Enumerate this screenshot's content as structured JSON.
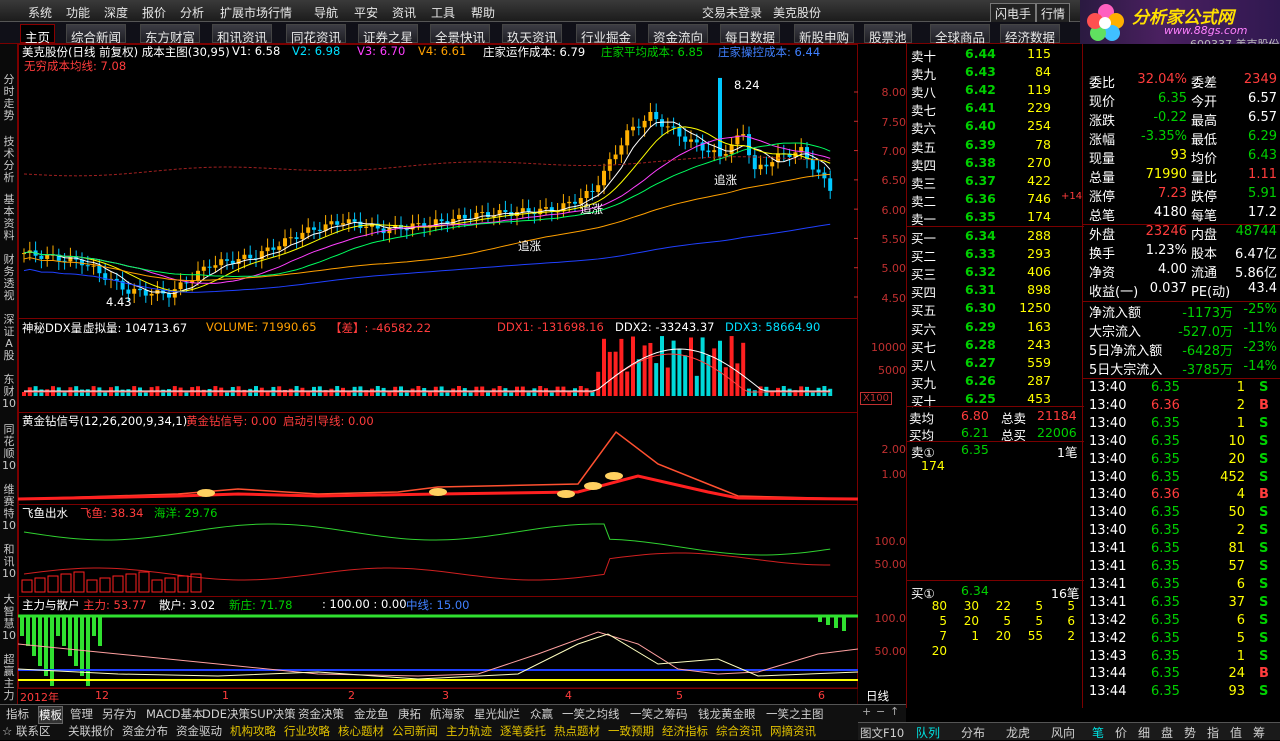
{
  "menu": [
    "系统",
    "功能",
    "深度",
    "报价",
    "分析",
    "扩展市场行情",
    "导航",
    "平安",
    "资讯",
    "工具",
    "帮助"
  ],
  "status": {
    "login": "交易未登录",
    "stock": "美克股份",
    "btn1": "闪电手",
    "btn2": "行情"
  },
  "logo": {
    "title": "分析家公式网",
    "url": "www.88gs.com",
    "code": "600337 美克股份"
  },
  "tabs": [
    "主页",
    "综合新闻",
    "东方财富",
    "和讯资讯",
    "同花资讯",
    "证券之星",
    "全景快讯",
    "玖天资讯",
    "行业掘金",
    "资金流向",
    "每日数据",
    "新股申购",
    "股票池",
    "全球商品",
    "经济数据"
  ],
  "left_nav": [
    "分时走势",
    "技术分析",
    "基本资料",
    "财务透视",
    "深证A股",
    "东财10",
    "同花顺10",
    "维赛特10",
    "和讯10",
    "大智慧10",
    "超赢主力"
  ],
  "main_panel": {
    "title": "美克股份(日线 前复权) 成本主图(30,95)",
    "v1": "V1: 6.58",
    "v2": "V2: 6.98",
    "v3": "V3: 6.70",
    "v4": "V4: 6.61",
    "zhuang": "庄家运作成本: 6.79",
    "avg": "庄家平均成本: 6.85",
    "zhuang2": "庄家操控成本: 6.44",
    "inf": "无穷成本均线: 7.08",
    "hi": "8.24",
    "lo": "4.43",
    "tag1": "追涨",
    "tag2": "追涨",
    "tag3": "追涨",
    "yticks": [
      "8.00",
      "7.50",
      "7.00",
      "6.50",
      "6.00",
      "5.50",
      "5.00",
      "4.50"
    ]
  },
  "ddx_panel": {
    "title": "神秘DDX量",
    "virt": "虚拟量: 104713.67",
    "vol": "VOLUME: 71990.65",
    "diff": "【差】: -46582.22",
    "ddx1": "DDX1: -131698.16",
    "ddx2": "DDX2: -33243.37",
    "ddx3": "DDX3: 58664.90",
    "yticks": [
      "10000",
      "5000"
    ],
    "x100": "X100",
    "buy": "买",
    "sell": "卖"
  },
  "gold_panel": {
    "title": "黄金钻信号(12,26,200,9,34,1)",
    "sig": "黄金钻信号: 0.00",
    "guide": "启动引导线: 0.00",
    "yticks": [
      "2.00",
      "1.00"
    ]
  },
  "fish_panel": {
    "title": "飞鱼出水",
    "fish": "飞鱼: 38.34",
    "sea": "海洋: 29.76",
    "yticks": [
      "100.0",
      "50.00"
    ]
  },
  "main_retail": {
    "title": "主力与散户",
    "main": "主力: 53.77",
    "retail": "散户: 3.02",
    "new": "新庄: 71.78",
    "fixed": ": 100.00 : 0.00",
    "mid": "中线: 15.00",
    "yticks": [
      "100.0",
      "50.00"
    ]
  },
  "xaxis": {
    "year": "2012年",
    "labels": [
      "12",
      "1",
      "2",
      "3",
      "4",
      "5",
      "6"
    ],
    "period": "日线"
  },
  "chart_data": {
    "type": "candlestick",
    "ylim": [
      4.3,
      8.4
    ],
    "price_ticks": [
      8.0,
      7.5,
      7.0,
      6.5,
      6.0,
      5.5,
      5.0,
      4.5
    ],
    "high": 8.24,
    "low": 4.43,
    "last": 6.35
  },
  "sell_book": [
    {
      "label": "卖十",
      "price": "6.44",
      "vol": "115"
    },
    {
      "label": "卖九",
      "price": "6.43",
      "vol": "84"
    },
    {
      "label": "卖八",
      "price": "6.42",
      "vol": "119"
    },
    {
      "label": "卖七",
      "price": "6.41",
      "vol": "229"
    },
    {
      "label": "卖六",
      "price": "6.40",
      "vol": "254"
    },
    {
      "label": "卖五",
      "price": "6.39",
      "vol": "78"
    },
    {
      "label": "卖四",
      "price": "6.38",
      "vol": "270"
    },
    {
      "label": "卖三",
      "price": "6.37",
      "vol": "422"
    },
    {
      "label": "卖二",
      "price": "6.36",
      "vol": "746",
      "ex": "+14"
    },
    {
      "label": "卖一",
      "price": "6.35",
      "vol": "174"
    }
  ],
  "buy_book": [
    {
      "label": "买一",
      "price": "6.34",
      "vol": "288"
    },
    {
      "label": "买二",
      "price": "6.33",
      "vol": "293"
    },
    {
      "label": "买三",
      "price": "6.32",
      "vol": "406"
    },
    {
      "label": "买四",
      "price": "6.31",
      "vol": "898"
    },
    {
      "label": "买五",
      "price": "6.30",
      "vol": "1250"
    },
    {
      "label": "买六",
      "price": "6.29",
      "vol": "163"
    },
    {
      "label": "买七",
      "price": "6.28",
      "vol": "243"
    },
    {
      "label": "买八",
      "price": "6.27",
      "vol": "559"
    },
    {
      "label": "买九",
      "price": "6.26",
      "vol": "287"
    },
    {
      "label": "买十",
      "price": "6.25",
      "vol": "453"
    }
  ],
  "book_summary": {
    "sell_avg_l": "卖均",
    "sell_avg": "6.80",
    "sell_tot_l": "总卖",
    "sell_tot": "21184",
    "buy_avg_l": "买均",
    "buy_avg": "6.21",
    "buy_tot_l": "总买",
    "buy_tot": "22006"
  },
  "queue": {
    "s1": "卖①",
    "s1p": "6.35",
    "s1n": "1笔",
    "s1v": "174",
    "b1": "买①",
    "b1p": "6.34",
    "b1n": "16笔",
    "rows": [
      [
        "80",
        "30",
        "22",
        "5",
        "5"
      ],
      [
        "5",
        "20",
        "5",
        "5",
        "6"
      ],
      [
        "7",
        "1",
        "20",
        "55",
        "2"
      ],
      [
        "20",
        "",
        "",
        "",
        ""
      ]
    ]
  },
  "quote": [
    {
      "l1": "委比",
      "v1": "32.04%",
      "l2": "委差",
      "v2": "2349",
      "c1": "red",
      "c2": "red"
    },
    {
      "l1": "现价",
      "v1": "6.35",
      "l2": "今开",
      "v2": "6.57",
      "c1": "grn",
      "c2": "wht"
    },
    {
      "l1": "涨跌",
      "v1": "-0.22",
      "l2": "最高",
      "v2": "6.57",
      "c1": "grn",
      "c2": "wht"
    },
    {
      "l1": "涨幅",
      "v1": "-3.35%",
      "l2": "最低",
      "v2": "6.29",
      "c1": "grn",
      "c2": "grn"
    },
    {
      "l1": "现量",
      "v1": "93",
      "l2": "均价",
      "v2": "6.43",
      "c1": "yel",
      "c2": "grn"
    },
    {
      "l1": "总量",
      "v1": "71990",
      "l2": "量比",
      "v2": "1.11",
      "c1": "yel",
      "c2": "red"
    },
    {
      "l1": "涨停",
      "v1": "7.23",
      "l2": "跌停",
      "v2": "5.91",
      "c1": "red",
      "c2": "grn"
    },
    {
      "l1": "总笔",
      "v1": "4180",
      "l2": "每笔",
      "v2": "17.2",
      "c1": "wht",
      "c2": "wht"
    },
    {
      "l1": "外盘",
      "v1": "23246",
      "l2": "内盘",
      "v2": "48744",
      "c1": "red",
      "c2": "grn"
    },
    {
      "l1": "换手",
      "v1": "1.23%",
      "l2": "股本",
      "v2": "6.47亿",
      "c1": "wht",
      "c2": "wht"
    },
    {
      "l1": "净资",
      "v1": "4.00",
      "l2": "流通",
      "v2": "5.86亿",
      "c1": "wht",
      "c2": "wht"
    },
    {
      "l1": "收益(一)",
      "v1": "0.037",
      "l2": "PE(动)",
      "v2": "43.4",
      "c1": "wht",
      "c2": "wht"
    }
  ],
  "flow": [
    {
      "l": "净流入额",
      "v": "-1173万",
      "p": "-25%"
    },
    {
      "l": "大宗流入",
      "v": "-527.0万",
      "p": "-11%"
    },
    {
      "l": "5日净流入额",
      "v": "-6428万",
      "p": "-23%"
    },
    {
      "l": "5日大宗流入",
      "v": "-3785万",
      "p": "-14%"
    }
  ],
  "ticks": [
    [
      "13:40",
      "6.35",
      "1",
      "S"
    ],
    [
      "13:40",
      "6.36",
      "2",
      "B"
    ],
    [
      "13:40",
      "6.35",
      "1",
      "S"
    ],
    [
      "13:40",
      "6.35",
      "10",
      "S"
    ],
    [
      "13:40",
      "6.35",
      "20",
      "S"
    ],
    [
      "13:40",
      "6.35",
      "452",
      "S"
    ],
    [
      "13:40",
      "6.36",
      "4",
      "B"
    ],
    [
      "13:40",
      "6.35",
      "50",
      "S"
    ],
    [
      "13:40",
      "6.35",
      "2",
      "S"
    ],
    [
      "13:41",
      "6.35",
      "81",
      "S"
    ],
    [
      "13:41",
      "6.35",
      "57",
      "S"
    ],
    [
      "13:41",
      "6.35",
      "6",
      "S"
    ],
    [
      "13:41",
      "6.35",
      "37",
      "S"
    ],
    [
      "13:42",
      "6.35",
      "6",
      "S"
    ],
    [
      "13:42",
      "6.35",
      "5",
      "S"
    ],
    [
      "13:43",
      "6.35",
      "1",
      "S"
    ],
    [
      "13:44",
      "6.35",
      "24",
      "B"
    ],
    [
      "13:44",
      "6.35",
      "93",
      "S"
    ]
  ],
  "bottom_row1": [
    "指标",
    "模板",
    "管理",
    "另存为",
    "MACD基本",
    "DDE决策",
    "SUP决策",
    "资金决策",
    "金龙鱼",
    "庚拓",
    "航海家",
    "星光灿烂",
    "众赢",
    "一笑之均线",
    "一笑之筹码",
    "钱龙黄金眼",
    "一笑之主图"
  ],
  "bottom_row2": [
    "☆ 联系区",
    "关联报价",
    "资金分布",
    "资金驱动",
    "机构攻略",
    "行业攻略",
    "核心题材",
    "公司新闻",
    "主力轨迹",
    "逐笔委托",
    "热点题材",
    "一致预期",
    "经济指标",
    "综合资讯",
    "网摘资讯"
  ],
  "bottom_right": {
    "btn": "图文F10",
    "tabs": [
      "队列",
      "分布",
      "龙虎",
      "风向"
    ],
    "small": [
      "笔",
      "价",
      "细",
      "盘",
      "势",
      "指",
      "值",
      "筹"
    ]
  }
}
